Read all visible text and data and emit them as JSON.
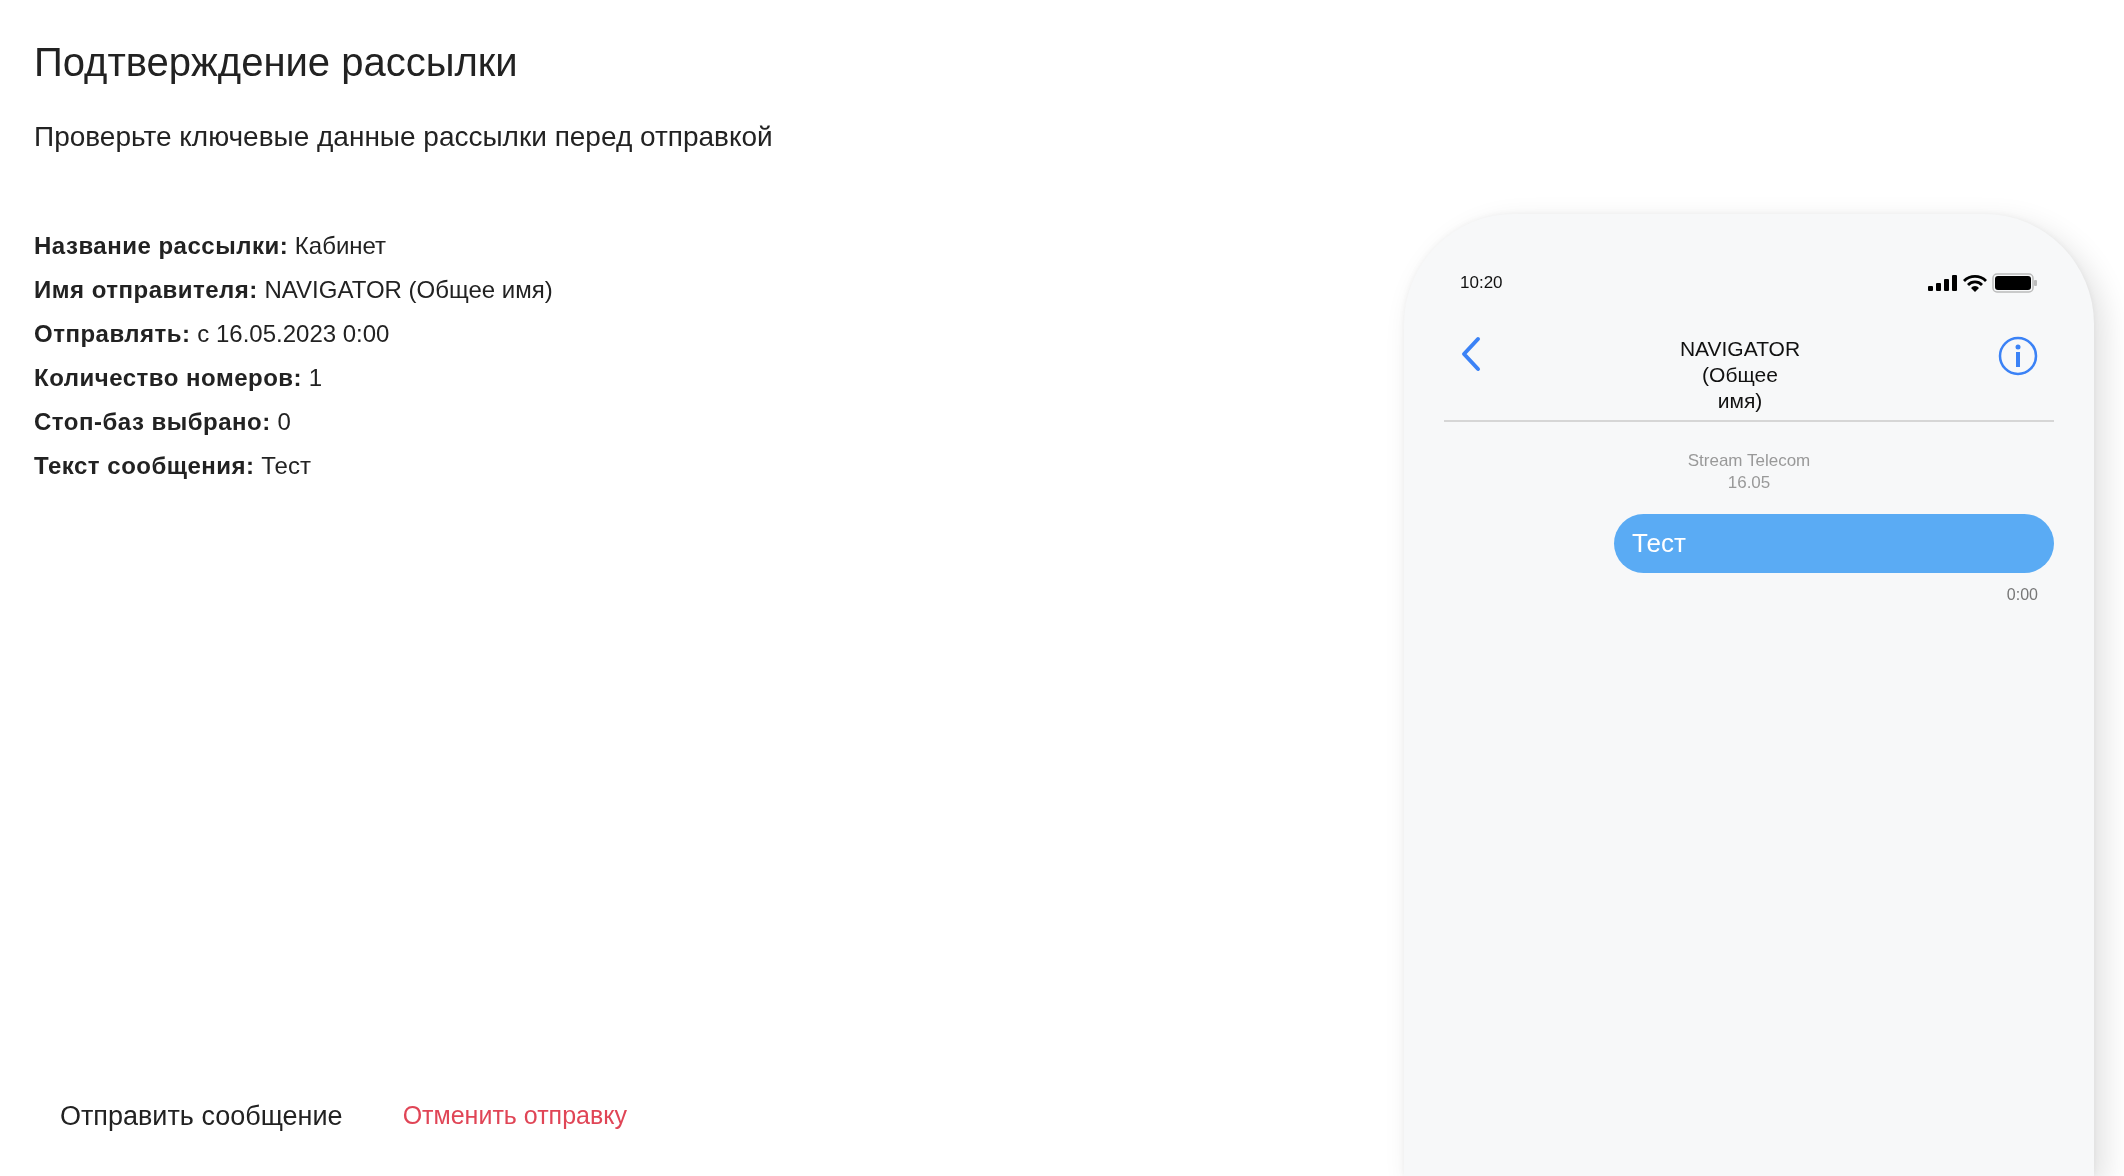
{
  "title": "Подтверждение рассылки",
  "subtitle": "Проверьте ключевые данные рассылки перед отправкой",
  "details": [
    {
      "label": "Название рассылки:",
      "value": "Кабинет"
    },
    {
      "label": "Имя отправителя:",
      "value": "NAVIGATOR (Общее имя)"
    },
    {
      "label": "Отправлять:",
      "value": "с 16.05.2023 0:00"
    },
    {
      "label": "Количество номеров:",
      "value": "1"
    },
    {
      "label": "Стоп-баз выбрано:",
      "value": "0"
    },
    {
      "label": "Текст сообщения:",
      "value": "Тест"
    }
  ],
  "actions": [
    {
      "label": "Отправить сообщение",
      "kind": "primary"
    },
    {
      "label": "Отменить отправку",
      "kind": "cancel"
    }
  ],
  "phone": {
    "time": "10:20",
    "contact": "NAVIGATOR (Общее имя)",
    "sender": "Stream Telecom",
    "date": "16.05",
    "messages": [
      {
        "text": "Тест",
        "time": "0:00"
      }
    ]
  }
}
